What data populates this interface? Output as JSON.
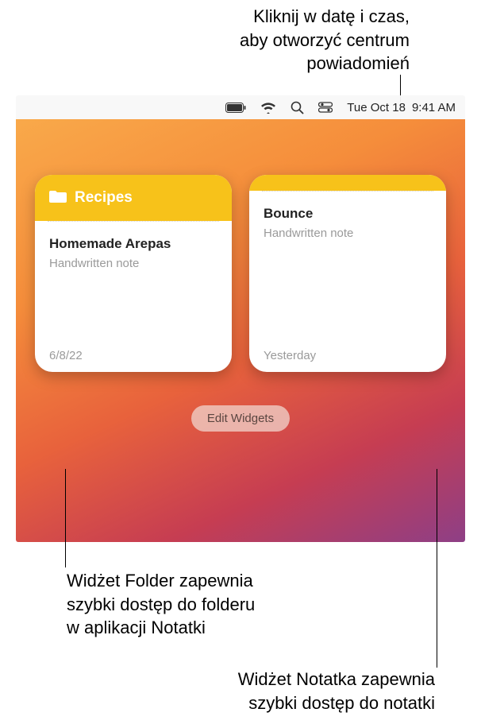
{
  "annotations": {
    "top": "Kliknij w datę i czas,\naby otworzyć centrum\npowiadomień",
    "left": "Widżet Folder zapewnia\nszybki dostęp do folderu\nw aplikacji Notatki",
    "right": "Widżet Notatka zapewnia\nszybki dostęp do notatki"
  },
  "menubar": {
    "date": "Tue Oct 18",
    "time": "9:41 AM"
  },
  "widgets": {
    "folder": {
      "title": "Recipes",
      "note_title": "Homemade Arepas",
      "note_subtitle": "Handwritten note",
      "note_date": "6/8/22"
    },
    "note": {
      "note_title": "Bounce",
      "note_subtitle": "Handwritten note",
      "note_date": "Yesterday"
    }
  },
  "edit_button": "Edit Widgets"
}
